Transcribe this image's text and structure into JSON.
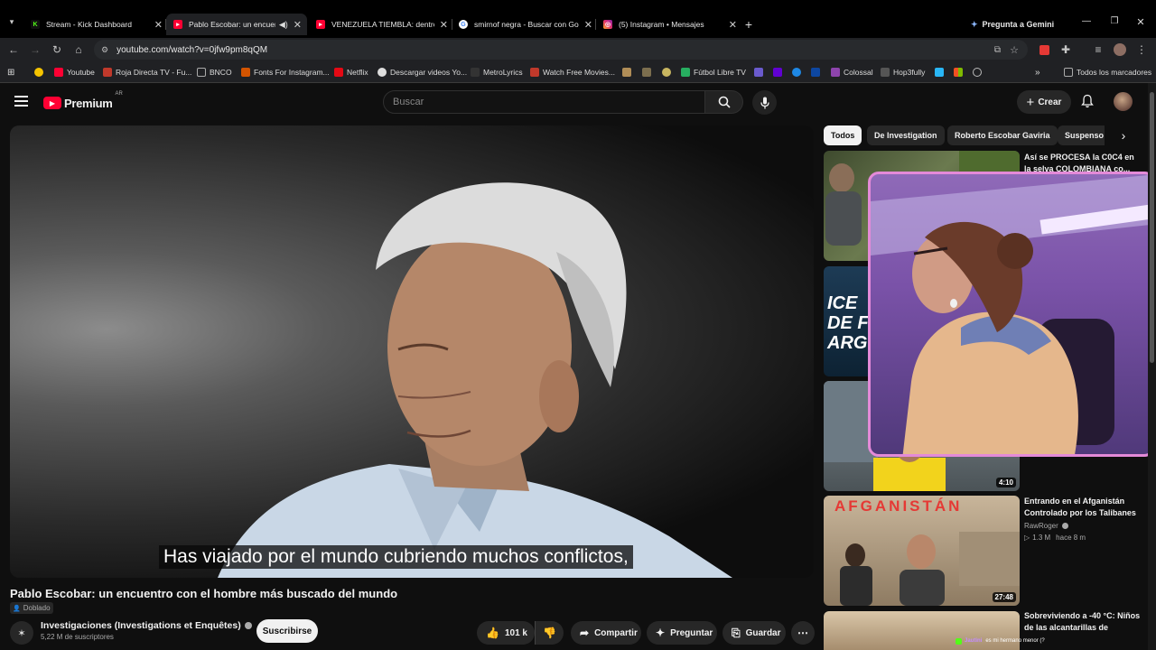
{
  "browser": {
    "tabs": [
      {
        "title": "Stream - Kick Dashboard",
        "favicon": "kick-icon",
        "color": "#53fc18"
      },
      {
        "title": "Pablo Escobar: un encuentro con el hombre más buscado del mundo",
        "favicon": "youtube-icon",
        "color": "#ff0033",
        "audio": true
      },
      {
        "title": "VENEZUELA TIEMBLA: dentro de",
        "favicon": "youtube-icon",
        "color": "#ff0033"
      },
      {
        "title": "smirnof negra - Buscar con Google",
        "favicon": "google-icon",
        "color": "#4285f4"
      },
      {
        "title": "(5) Instagram • Mensajes",
        "favicon": "instagram-icon",
        "color": "#e1306c"
      }
    ],
    "gemini_label": "Pregunta a Gemini",
    "url": "youtube.com/watch?v=0jfw9pm8qQM",
    "bookmarks": [
      {
        "label": "",
        "color": "#f5c400"
      },
      {
        "label": "Youtube",
        "color": "#ff0033"
      },
      {
        "label": "Roja Directa TV - Fu...",
        "color": "#c0392b"
      },
      {
        "label": "BNCO",
        "color": "#888"
      },
      {
        "label": "Fonts For Instagram...",
        "color": "#d35400"
      },
      {
        "label": "Netflix",
        "color": "#e50914"
      },
      {
        "label": "Descargar videos Yo...",
        "color": "#ddd"
      },
      {
        "label": "MetroLyrics",
        "color": "#333"
      },
      {
        "label": "Watch Free Movies...",
        "color": "#c0392b"
      },
      {
        "label": "Fútbol Libre TV",
        "color": "#27ae60"
      },
      {
        "label": "Colossal",
        "color": "#8e44ad"
      },
      {
        "label": "Hop3fully",
        "color": "#555"
      }
    ],
    "all_bookmarks_label": "Todos los marcadores"
  },
  "youtube": {
    "logo_text": "Premium",
    "region": "AR",
    "search_placeholder": "Buscar",
    "create_label": "Crear",
    "subtitle": "Has viajado por el mundo cubriendo muchos conflictos,",
    "video_title": "Pablo Escobar: un encuentro con el hombre más buscado del mundo",
    "dubbed_label": "Doblado",
    "channel_name": "Investigaciones (Investigations et Enquêtes)",
    "subscribers": "5,22 M de suscriptores",
    "subscribe_label": "Suscribirse",
    "likes": "101 k",
    "share_label": "Compartir",
    "ask_label": "Preguntar",
    "save_label": "Guardar",
    "chips": [
      "Todos",
      "De Investigation",
      "Roberto Escobar Gaviria",
      "Suspenso"
    ],
    "related": [
      {
        "title": "Así se PROCESA la C0C4 en la selva COLOMBIANA co...",
        "channel": "",
        "views": "",
        "age": "",
        "duration": ""
      },
      {
        "title": "",
        "channel": "",
        "views": "",
        "age": "",
        "duration": ""
      },
      {
        "title": "",
        "channel": "",
        "views": "",
        "age": "",
        "duration": "4:10"
      },
      {
        "title": "Entrando en el Afganistán Controlado por los Talibanes",
        "channel": "RawRoger",
        "views": "1.3 M",
        "age": "hace 8 m",
        "duration": "27:48",
        "thumb_text": "AFGANISTÁN"
      },
      {
        "title": "Sobreviviendo a -40 °C: Niños de las alcantarillas de",
        "channel": "",
        "views": "",
        "age": "",
        "duration": ""
      }
    ],
    "related_thumb_text_2": "ICE DE F ARG"
  },
  "chat": {
    "user": "Jautini",
    "message": "es mi hermano menor (?"
  }
}
